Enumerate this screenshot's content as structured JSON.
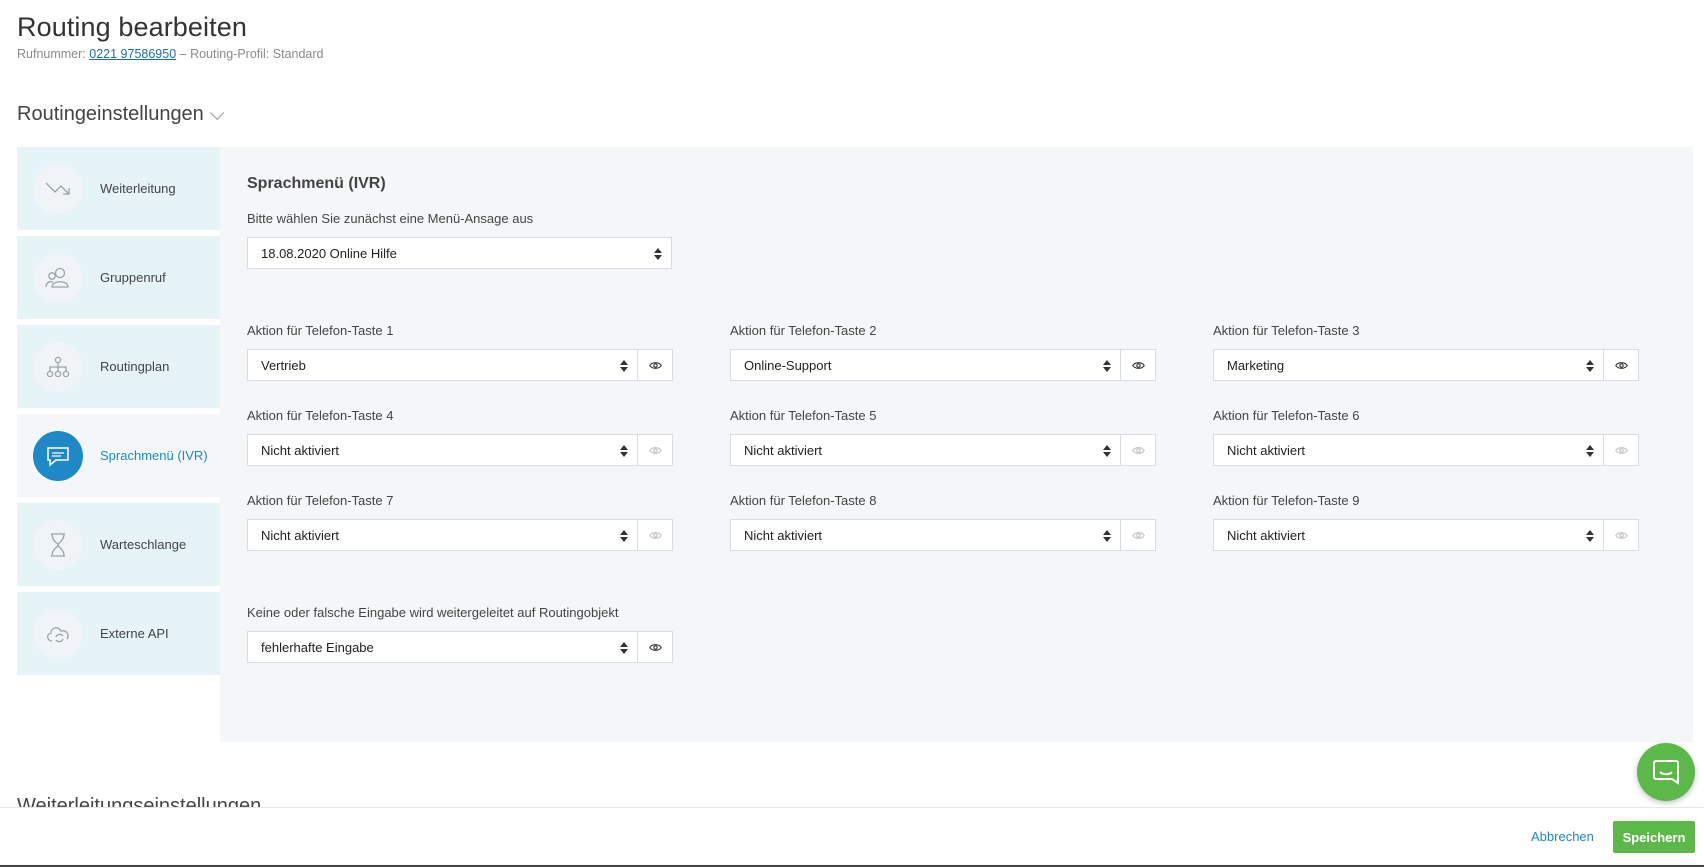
{
  "header": {
    "title": "Routing bearbeiten",
    "phone_label": "Rufnummer:",
    "phone_number": "0221 97586950",
    "profile_text": "– Routing-Profil: Standard"
  },
  "section": {
    "title": "Routingeinstellungen"
  },
  "sidebar": {
    "items": [
      {
        "label": "Weiterleitung",
        "icon": "forward-arrow-icon"
      },
      {
        "label": "Gruppenruf",
        "icon": "group-icon"
      },
      {
        "label": "Routingplan",
        "icon": "hierarchy-icon"
      },
      {
        "label": "Sprachmenü (IVR)",
        "icon": "speech-bubble-icon"
      },
      {
        "label": "Warteschlange",
        "icon": "hourglass-icon"
      },
      {
        "label": "Externe API",
        "icon": "cloud-sync-icon"
      }
    ],
    "active_index": 3
  },
  "ivr": {
    "title": "Sprachmenü (IVR)",
    "announcement_label": "Bitte wählen Sie zunächst eine Menü-Ansage aus",
    "announcement_value": "18.08.2020 Online Hilfe",
    "keys": [
      {
        "label": "Aktion für Telefon-Taste 1",
        "value": "Vertrieb",
        "preview": true
      },
      {
        "label": "Aktion für Telefon-Taste 2",
        "value": "Online-Support",
        "preview": true
      },
      {
        "label": "Aktion für Telefon-Taste 3",
        "value": "Marketing",
        "preview": true
      },
      {
        "label": "Aktion für Telefon-Taste 4",
        "value": "Nicht aktiviert",
        "preview": false
      },
      {
        "label": "Aktion für Telefon-Taste 5",
        "value": "Nicht aktiviert",
        "preview": false
      },
      {
        "label": "Aktion für Telefon-Taste 6",
        "value": "Nicht aktiviert",
        "preview": false
      },
      {
        "label": "Aktion für Telefon-Taste 7",
        "value": "Nicht aktiviert",
        "preview": false
      },
      {
        "label": "Aktion für Telefon-Taste 8",
        "value": "Nicht aktiviert",
        "preview": false
      },
      {
        "label": "Aktion für Telefon-Taste 9",
        "value": "Nicht aktiviert",
        "preview": false
      }
    ],
    "fallback_label": "Keine oder falsche Eingabe wird weitergeleitet auf Routingobjekt",
    "fallback_value": "fehlerhafte Eingabe"
  },
  "footer": {
    "next_section": "Weiterleitungseinstellungen",
    "cancel_label": "Abbrechen",
    "save_label": "Speichern"
  },
  "colors": {
    "accent": "#1e88c8",
    "save": "#5cb848",
    "sidebar_bg": "#e6f4f8",
    "panel_bg": "#f4f6f8"
  }
}
